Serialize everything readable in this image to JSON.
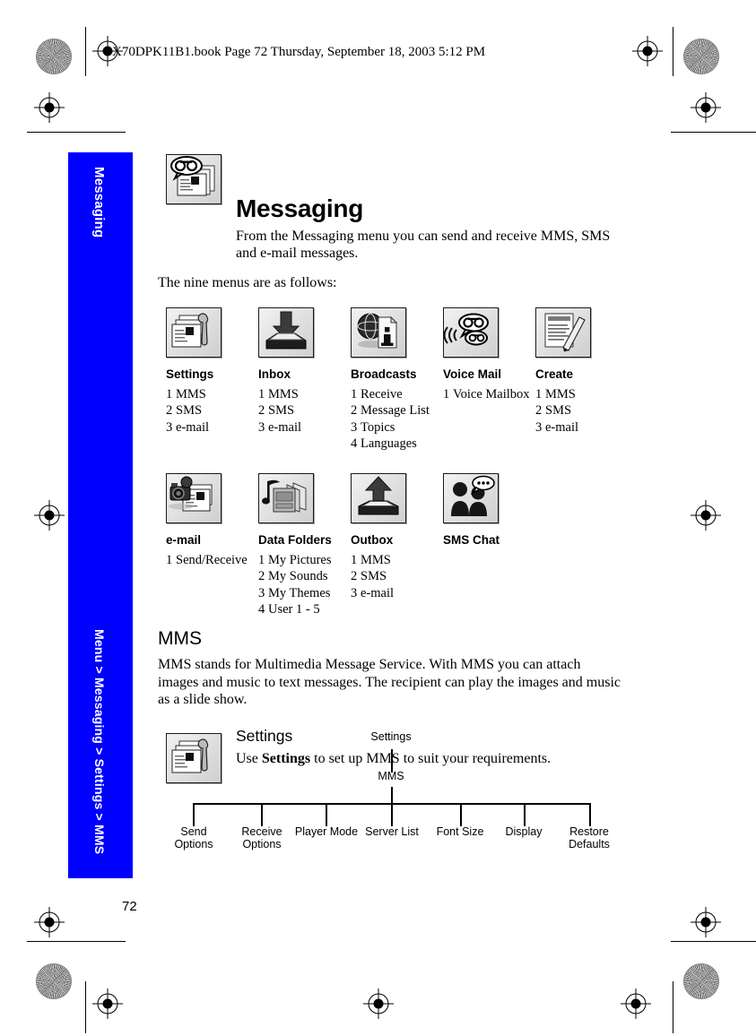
{
  "header": {
    "running_text": "X70DPK11B1.book  Page 72  Thursday, September 18, 2003  5:12 PM"
  },
  "sidebar": {
    "chapter_label": "Messaging",
    "breadcrumb": "Menu > Messaging > Settings > MMS",
    "color": "#0000ff",
    "text_color": "#ffffff"
  },
  "page": {
    "title": "Messaging",
    "title_icon": "messaging-icon",
    "intro": "From the Messaging menu you can send and receive MMS, SMS and e-mail messages.",
    "lead": "The nine menus are as follows:",
    "number": "72"
  },
  "menus": [
    {
      "name": "Settings",
      "icon": "settings-messages-icon",
      "items": [
        {
          "n": "1",
          "label": "MMS"
        },
        {
          "n": "2",
          "label": "SMS"
        },
        {
          "n": "3",
          "label": "e-mail"
        }
      ]
    },
    {
      "name": "Inbox",
      "icon": "inbox-tray-down-arrow-icon",
      "items": [
        {
          "n": "1",
          "label": "MMS"
        },
        {
          "n": "2",
          "label": "SMS"
        },
        {
          "n": "3",
          "label": "e-mail"
        }
      ]
    },
    {
      "name": "Broadcasts",
      "icon": "globe-info-icon",
      "items": [
        {
          "n": "1",
          "label": "Receive"
        },
        {
          "n": "2",
          "label": "Message List"
        },
        {
          "n": "3",
          "label": "Topics"
        },
        {
          "n": "4",
          "label": "Languages"
        }
      ]
    },
    {
      "name": "Voice Mail",
      "icon": "voice-mail-speech-bubbles-icon",
      "items": [
        {
          "n": "1",
          "label": "Voice Mailbox"
        }
      ]
    },
    {
      "name": "Create",
      "icon": "create-message-pencil-icon",
      "items": [
        {
          "n": "1",
          "label": "MMS"
        },
        {
          "n": "2",
          "label": "SMS"
        },
        {
          "n": "3",
          "label": "e-mail"
        }
      ]
    },
    {
      "name": "e-mail",
      "icon": "email-camera-icon",
      "items": [
        {
          "n": "1",
          "label": "Send/Receive"
        }
      ]
    },
    {
      "name": "Data Folders",
      "icon": "data-folders-music-icon",
      "items": [
        {
          "n": "1",
          "label": "My Pictures"
        },
        {
          "n": "2",
          "label": "My Sounds"
        },
        {
          "n": "3",
          "label": "My Themes"
        },
        {
          "n": "4",
          "label": "User 1 - 5"
        }
      ]
    },
    {
      "name": "Outbox",
      "icon": "outbox-tray-up-arrow-icon",
      "items": [
        {
          "n": "1",
          "label": "MMS"
        },
        {
          "n": "2",
          "label": "SMS"
        },
        {
          "n": "3",
          "label": "e-mail"
        }
      ]
    },
    {
      "name": "SMS Chat",
      "icon": "sms-chat-people-icon",
      "items": []
    }
  ],
  "mms_section": {
    "heading": "MMS",
    "body": "MMS stands for Multimedia Message Service. With MMS you can attach images and music to text messages. The recipient can play the images and music as a slide show.",
    "settings": {
      "icon": "settings-messages-icon",
      "heading": "Settings",
      "body_before": "Use ",
      "body_bold": "Settings",
      "body_after": " to set up MMS to suit your requirements."
    }
  },
  "tree": {
    "root": "Settings",
    "level2": "MMS",
    "leaves": [
      "Send\nOptions",
      "Receive\nOptions",
      "Player Mode",
      "Server List",
      "Font Size",
      "Display",
      "Restore\nDefaults"
    ]
  }
}
